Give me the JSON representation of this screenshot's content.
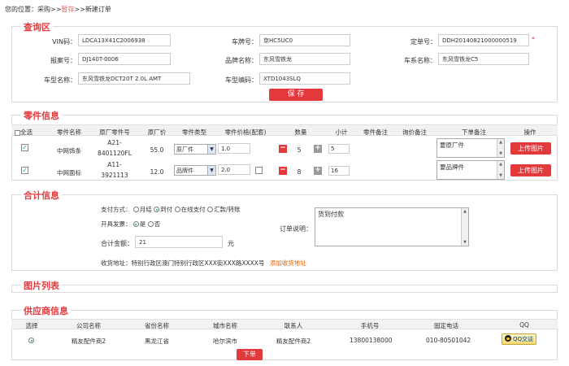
{
  "breadcrumb": {
    "prefix": "您的位置：",
    "step1": "采购>>",
    "step2": "暂存",
    "step3": ">>新建订单"
  },
  "query": {
    "title": "查询区",
    "vin_label": "VIN码：",
    "vin_value": "LDCA13X41C2006938",
    "plate_label": "车牌号：",
    "plate_value": "京HC5UC0",
    "quote_label": "定单号：",
    "quote_value": "DDH20140821000000519",
    "required_mark": "*",
    "insurer_label": "报案号：",
    "insurer_value": "DJ140T-0006",
    "brand_label": "品牌名称：",
    "brand_value": "东风雪铁龙",
    "series_label": "车系名称：",
    "series_value": "东风雪铁龙C5",
    "model_label": "车型名称：",
    "model_value": "东风雪铁龙DCT20T 2.0L AMT",
    "model_code_label": "车型编码：",
    "model_code_value": "XTD1043SLQ",
    "save_label": "保  存"
  },
  "parts": {
    "title": "零件信息",
    "headers": {
      "select_all": "全选",
      "name": "零件名称",
      "oem": "原厂零件号",
      "oem_price": "原厂价",
      "type": "零件类型",
      "ratio": "零件价格(配套)",
      "qty": "数量",
      "subtotal": "小计",
      "remark": "零件备注",
      "quote_remark": "询价备注",
      "order_remark": "下单备注",
      "action": "操作"
    },
    "rows": [
      {
        "name": "中网饰条",
        "oem_line1": "A21-",
        "oem_line2": "8401120FL",
        "price": "55.0",
        "type": "原厂件",
        "ratio": "1.0",
        "qty": "5",
        "subtotal": "5",
        "order_remark": "要原厂件",
        "upload": "上传图片"
      },
      {
        "name": "中网面标",
        "oem_line1": "A11-",
        "oem_line2": "3921113",
        "price": "12.0",
        "type": "品牌件",
        "ratio": "2.0",
        "qty": "8",
        "subtotal": "16",
        "order_remark": "要品牌件",
        "upload": "上传图片"
      }
    ],
    "minus": "−",
    "plus": "+"
  },
  "summary": {
    "title": "合计信息",
    "pay_label": "支付方式：",
    "pay_options": [
      "月结",
      "到付",
      "在线支付",
      "汇款/转账"
    ],
    "invoice_label": "开具发票：",
    "invoice_yes": "是",
    "invoice_no": "否",
    "total_label": "合计金额：",
    "total_value": "21",
    "total_unit": "元",
    "address_label": "收货地址：",
    "address_value": "特别行政区澳门特别行政区XXX街XXX路XXXX号",
    "add_address": "添加收货地址",
    "order_note_label": "订单说明：",
    "order_note_value": "货到付款"
  },
  "images": {
    "title": "图片列表"
  },
  "supplier": {
    "title": "供应商信息",
    "headers": {
      "select": "选择",
      "company": "公司名称",
      "province": "省份名称",
      "city": "城市名称",
      "contact": "联系人",
      "mobile": "手机号",
      "phone": "固定电话",
      "qq": "QQ"
    },
    "row": {
      "company": "精友配件商2",
      "province": "黑龙江省",
      "city": "哈尔滨市",
      "contact": "精友配件商2",
      "mobile": "13800138000",
      "phone": "010-80501042",
      "qq_label": "QQ交谈"
    },
    "submit_label": "下单"
  },
  "colors": {
    "accent": "#e4393c",
    "link": "#e65f00",
    "check": "#22aa77"
  }
}
